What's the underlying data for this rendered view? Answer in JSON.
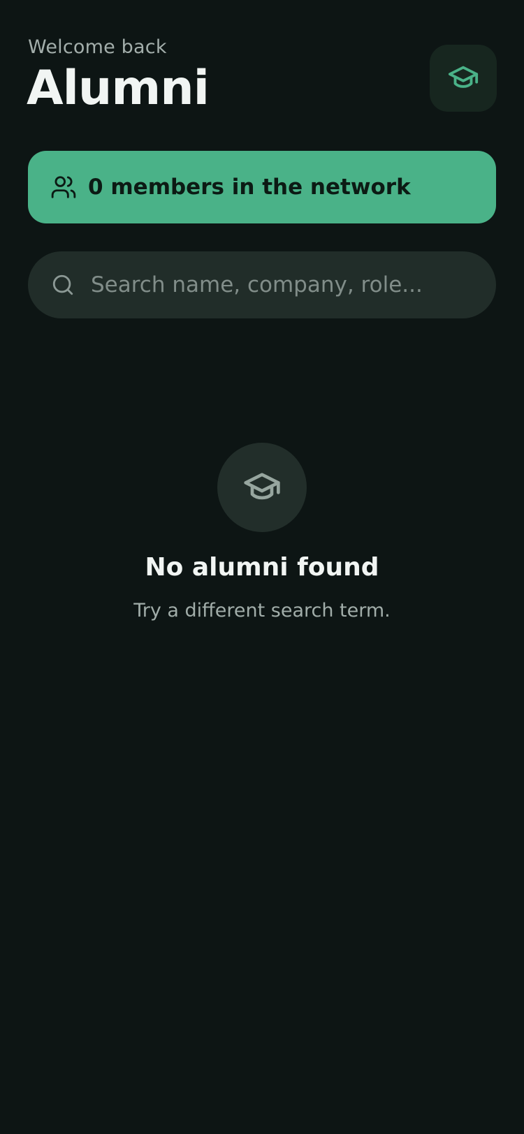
{
  "header": {
    "greeting": "Welcome back",
    "title": "Alumni",
    "profile_icon": "graduation-cap-icon"
  },
  "banner": {
    "icon": "users-icon",
    "text": "0 members in the network",
    "member_count": 0
  },
  "search": {
    "icon": "search-icon",
    "placeholder": "Search name, company, role...",
    "value": ""
  },
  "empty_state": {
    "icon": "graduation-cap-icon",
    "title": "No alumni found",
    "subtitle": "Try a different search term."
  },
  "colors": {
    "background": "#0d1514",
    "accent": "#4ab288",
    "surface": "#212d29",
    "profile_button": "#17261f",
    "text_primary": "#f1f5f3",
    "text_secondary": "#a3aeab"
  }
}
